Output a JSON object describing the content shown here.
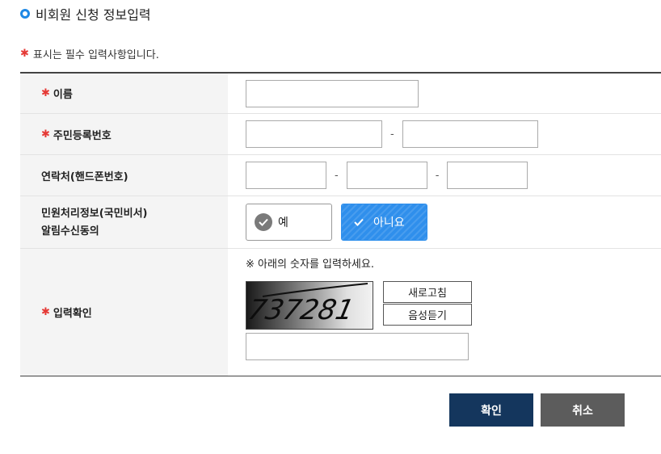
{
  "page": {
    "title": "비회원 신청 정보입력",
    "required_note": "표시는 필수 입력사항입니다."
  },
  "form": {
    "name_label": "이름",
    "rrn_label": "주민등록번호",
    "phone_label": "연락처(핸드폰번호)",
    "consent_label_line1": "민원처리정보(국민비서)",
    "consent_label_line2": "알림수신동의",
    "consent_yes": "예",
    "consent_no": "아니요",
    "consent_selected": "아니요",
    "captcha_label": "입력확인",
    "captcha_desc": "※ 아래의 숫자를 입력하세요.",
    "captcha_text": "737281",
    "refresh_button": "새로고침",
    "audio_button": "음성듣기",
    "dash": "-"
  },
  "actions": {
    "confirm": "확인",
    "cancel": "취소"
  },
  "icons": {
    "required": "asterisk-icon",
    "check": "check-icon",
    "title_bullet": "circle-bullet-icon"
  },
  "colors": {
    "accent": "#2f8fec",
    "required": "#e53935",
    "confirm_button": "#14365d",
    "cancel_button": "#5c5c5c"
  }
}
